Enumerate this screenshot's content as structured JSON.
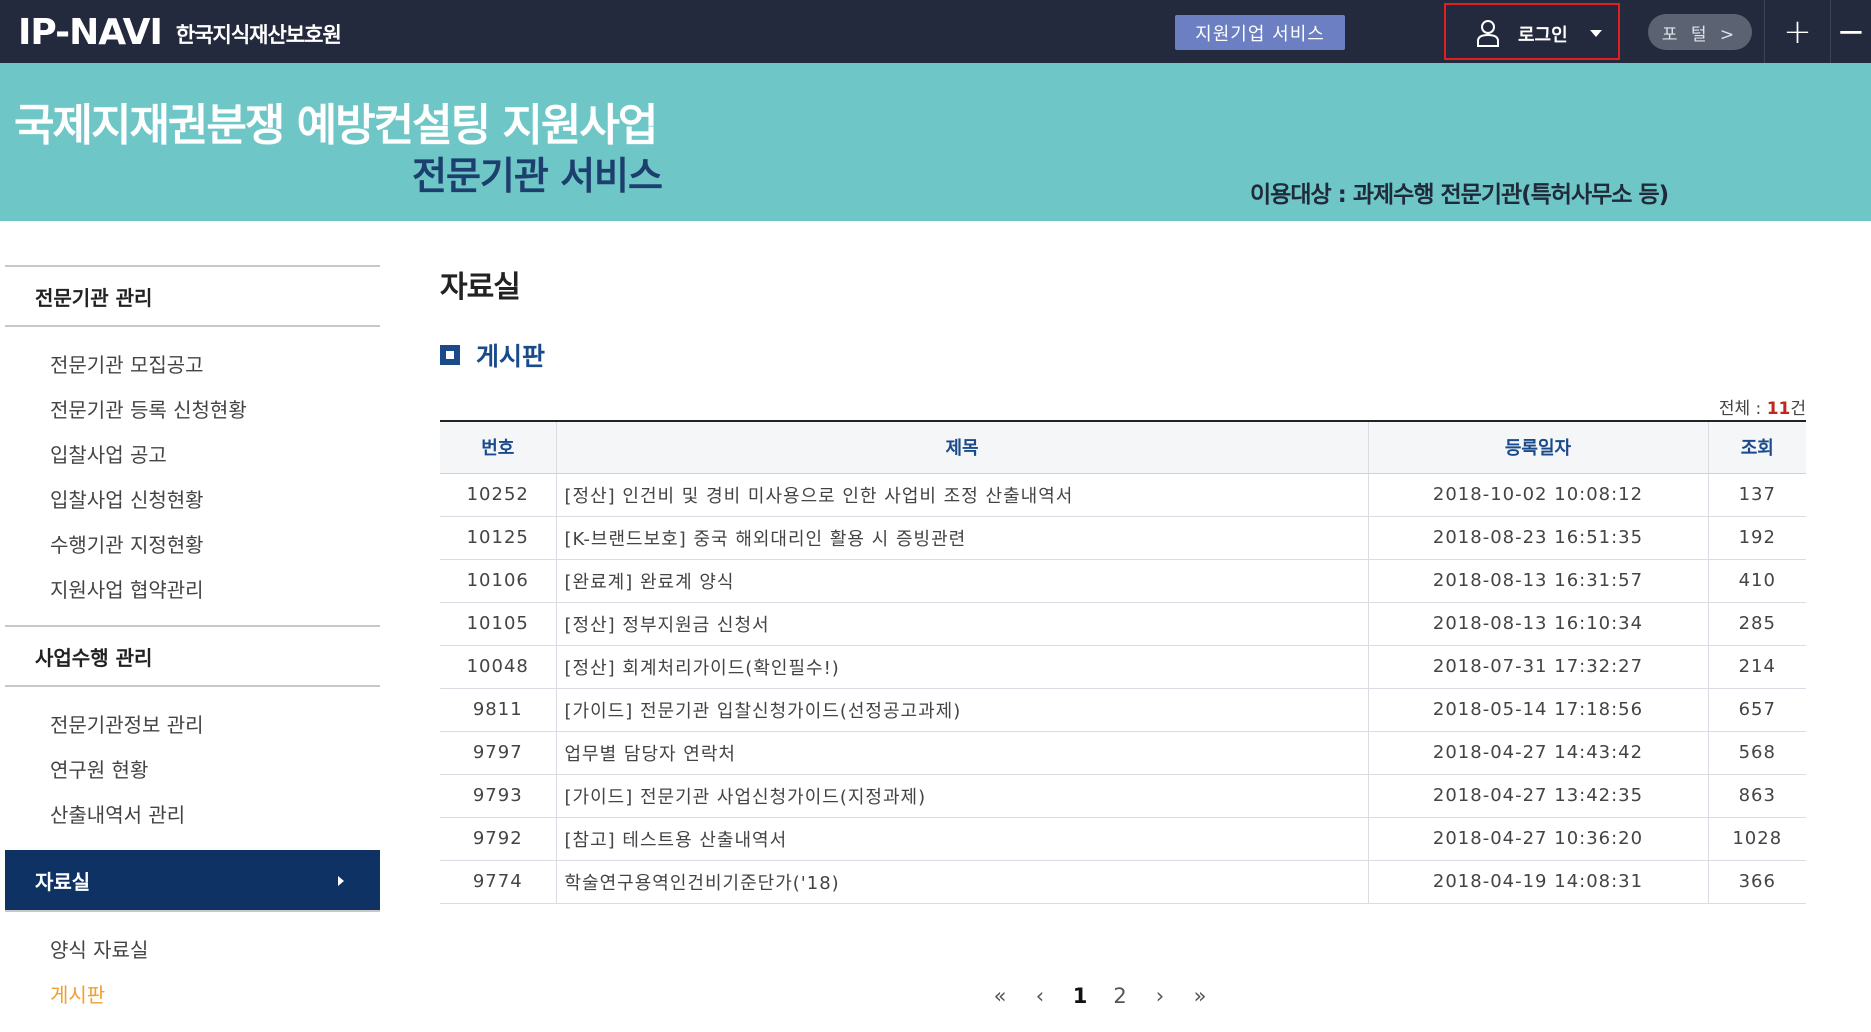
{
  "topbar": {
    "logo": "IP-NAVI",
    "logo_sub": "한국지식재산보호원",
    "service_button": "지원기업 서비스",
    "login_label": "로그인",
    "portal_label": "포 털 >",
    "plus_label": "+",
    "minus_label": "−"
  },
  "banner": {
    "title": "국제지재권분쟁 예방컨설팅 지원사업",
    "subtitle": "전문기관 서비스",
    "target": "이용대상 : 과제수행 전문기관(특허사무소 등)"
  },
  "sidebar": {
    "group1": "전문기관 관리",
    "group1_items": [
      "전문기관 모집공고",
      "전문기관 등록 신청현황",
      "입찰사업 공고",
      "입찰사업 신청현황",
      "수행기관 지정현황",
      "지원사업 협약관리"
    ],
    "group2": "사업수행 관리",
    "group2_items": [
      "전문기관정보 관리",
      "연구원 현황",
      "산출내역서 관리"
    ],
    "group3": "자료실",
    "group3_items": [
      "양식 자료실",
      "게시판"
    ]
  },
  "main": {
    "page_title": "자료실",
    "section_title": "게시판",
    "total_prefix": "전체 : ",
    "total_count": "11",
    "total_suffix": "건",
    "columns": [
      "번호",
      "제목",
      "등록일자",
      "조회"
    ],
    "rows": [
      {
        "no": "10252",
        "title": "[정산] 인건비 및 경비 미사용으로 인한 사업비 조정 산출내역서",
        "date": "2018-10-02 10:08:12",
        "views": "137"
      },
      {
        "no": "10125",
        "title": "[K-브랜드보호] 중국 해외대리인 활용 시 증빙관련",
        "date": "2018-08-23 16:51:35",
        "views": "192"
      },
      {
        "no": "10106",
        "title": "[완료계] 완료계 양식",
        "date": "2018-08-13 16:31:57",
        "views": "410"
      },
      {
        "no": "10105",
        "title": "[정산] 정부지원금 신청서",
        "date": "2018-08-13 16:10:34",
        "views": "285"
      },
      {
        "no": "10048",
        "title": "[정산] 회계처리가이드(확인필수!)",
        "date": "2018-07-31 17:32:27",
        "views": "214"
      },
      {
        "no": "9811",
        "title": "[가이드] 전문기관 입찰신청가이드(선정공고과제)",
        "date": "2018-05-14 17:18:56",
        "views": "657"
      },
      {
        "no": "9797",
        "title": "업무별 담당자 연락처",
        "date": "2018-04-27 14:43:42",
        "views": "568"
      },
      {
        "no": "9793",
        "title": "[가이드] 전문기관 사업신청가이드(지정과제)",
        "date": "2018-04-27 13:42:35",
        "views": "863"
      },
      {
        "no": "9792",
        "title": "[참고] 테스트용 산출내역서",
        "date": "2018-04-27 10:36:20",
        "views": "1028"
      },
      {
        "no": "9774",
        "title": "학술연구용역인건비기준단가('18)",
        "date": "2018-04-19 14:08:31",
        "views": "366"
      }
    ]
  },
  "pagination": {
    "first": "«",
    "prev": "‹",
    "pages": [
      "1",
      "2"
    ],
    "next": "›",
    "last": "»"
  }
}
